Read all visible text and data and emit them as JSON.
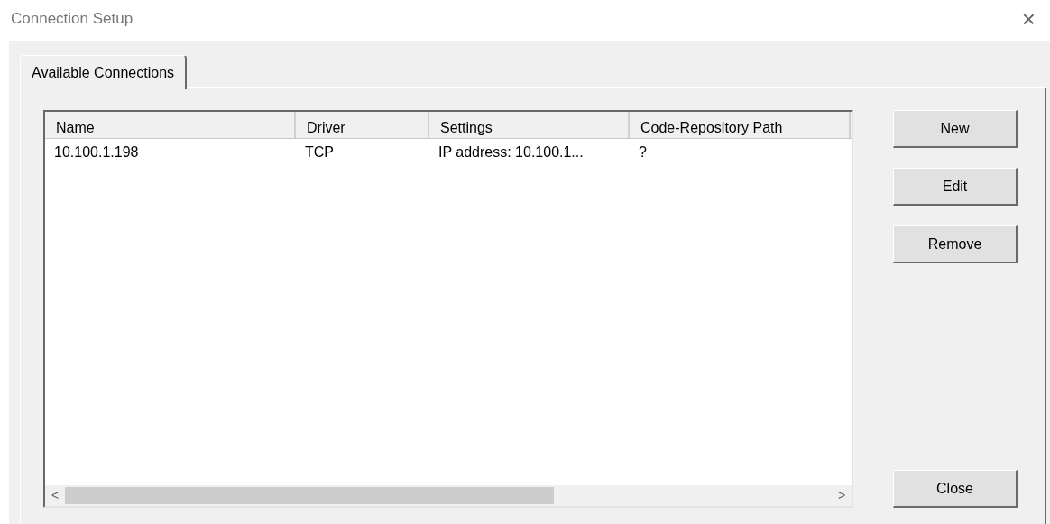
{
  "window": {
    "title": "Connection Setup",
    "close": "×"
  },
  "tabs": [
    {
      "label": "Available Connections",
      "selected": true
    }
  ],
  "table": {
    "columns": [
      "Name",
      "Driver",
      "Settings",
      "Code-Repository Path"
    ],
    "rows": [
      [
        "10.100.1.198",
        "TCP",
        "IP address: 10.100.1...",
        "?"
      ]
    ]
  },
  "scrollbar": {
    "left": "<",
    "right": ">"
  },
  "buttons": [
    "New",
    "Edit",
    "Remove"
  ],
  "close_button": "Close"
}
